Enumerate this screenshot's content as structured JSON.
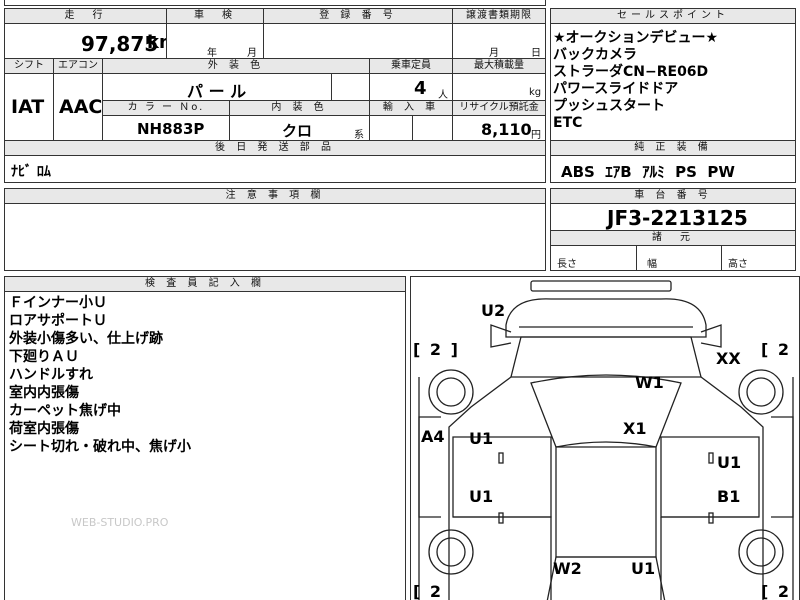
{
  "top_header": {
    "mileage_label": "走　行",
    "shaken_label": "車　検",
    "reg_label": "登 録 番 号",
    "transfer_label": "譲渡書類期限",
    "sales_label": "セールスポイント"
  },
  "mileage": {
    "value": "97,875",
    "unit": "km"
  },
  "shaken": {
    "year": "年",
    "month": "月"
  },
  "transfer": {
    "month": "月",
    "day": "日"
  },
  "row2_header": {
    "shift": "シフト",
    "aircon": "エアコン",
    "exterior": "外 装 色",
    "capacity": "乗車定員",
    "max_load": "最大積載量"
  },
  "shift_value": "IAT",
  "aircon_value": "AAC",
  "exterior_color": "パ ー ル",
  "capacity": {
    "value": "4",
    "unit": "人"
  },
  "max_load_unit": "kg",
  "row3_header": {
    "color_no": "カ ラ ー Ｎo.",
    "interior": "内 装 色",
    "import": "輸 入 車",
    "recycle": "リサイクル預託金"
  },
  "color_no": "NH883P",
  "interior": {
    "value": "クロ",
    "suffix": "系"
  },
  "recycle": {
    "value": "8,110",
    "unit": "円"
  },
  "later_parts": {
    "label": "後 日 発 送 部 品",
    "value": "ﾅﾋﾞ ﾛﾑ"
  },
  "caution": {
    "label": "注 意 事 項 欄"
  },
  "sales_points": [
    "★オークションデビュー★",
    "バックカメラ",
    "ストラーダCN−RE06D",
    "パワースライドドア",
    "プッシュスタート",
    "ETC"
  ],
  "equipment": {
    "label": "純 正 装 備",
    "value": "ABS  ｴｱB  ｱﾙﾐ  PS  PW"
  },
  "chassis": {
    "label": "車 台 番 号",
    "value": "JF3-2213125"
  },
  "dimensions": {
    "label": "諸　元",
    "length": "長さ",
    "width": "幅",
    "height": "高さ"
  },
  "inspector": {
    "label": "検 査 員 記 入 欄",
    "notes": [
      "Ｆインナー小Ｕ",
      "ロアサポートＵ",
      "外装小傷多い、仕上げ跡",
      "下廻りＡＵ",
      "ハンドルすれ",
      "室内内張傷",
      "カーペット焦げ中",
      "荷室内張傷",
      "シート切れ・破れ中、焦げ小"
    ],
    "watermark": "WEB-STUDIO.PRO"
  },
  "diagram": {
    "tire_tl": "[ 2 ]",
    "tire_tr": "[ 2 ]",
    "tire_bl": "[ 2",
    "tire_br": "[ 2",
    "marks": {
      "u2": "U2",
      "xx": "XX",
      "w1": "W1",
      "x1": "X1",
      "a4": "A4",
      "u1_left_front": "U1",
      "u1_right_front": "U1",
      "u1_left_rear": "U1",
      "b1": "B1",
      "w2": "W2",
      "u1_rear": "U1"
    }
  },
  "colors": {
    "header_bg": "#e8e8e8",
    "border": "#333333"
  }
}
